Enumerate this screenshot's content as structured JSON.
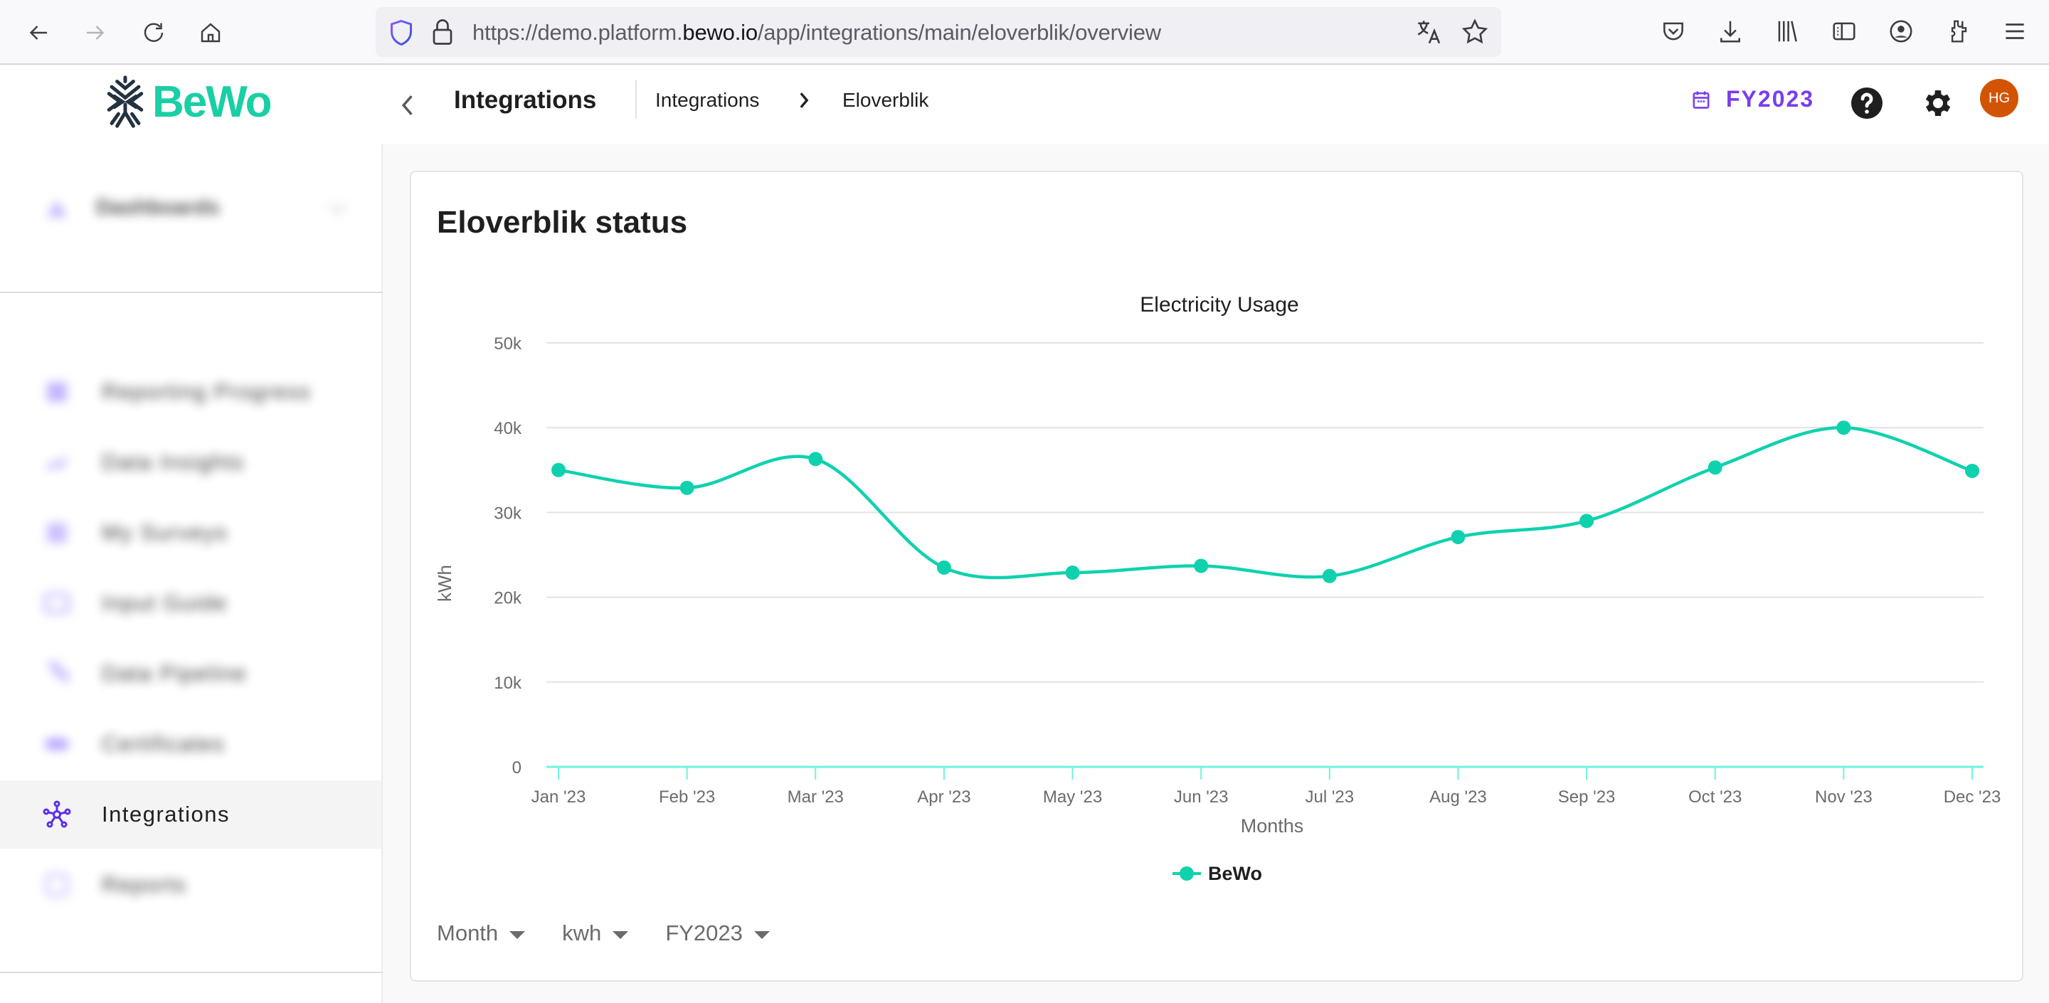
{
  "browser": {
    "url_prefix": "https://demo.platform.",
    "url_host": "bewo.io",
    "url_path": "/app/integrations/main/eloverblik/overview",
    "icons": [
      "back-icon",
      "forward-icon",
      "reload-icon",
      "home-icon",
      "shield-icon",
      "lock-icon",
      "translate-icon",
      "bookmark-star-icon",
      "pocket-icon",
      "download-icon",
      "library-icon",
      "sidebar-icon",
      "account-icon",
      "extensions-icon",
      "menu-icon"
    ]
  },
  "header": {
    "logo_text": "BeWo",
    "page_title": "Integrations",
    "breadcrumb": [
      "Integrations",
      "Eloverblik"
    ],
    "fiscal_year": "FY2023",
    "avatar_initials": "HG"
  },
  "sidebar": {
    "dashboards_label": "Dashboards",
    "items": [
      {
        "label": "Reporting Progress",
        "icon": "progress-icon",
        "blurred": true
      },
      {
        "label": "Data Insights",
        "icon": "insights-icon",
        "blurred": true
      },
      {
        "label": "My Surveys",
        "icon": "survey-icon",
        "blurred": true
      },
      {
        "label": "Input Guide",
        "icon": "guide-icon",
        "blurred": true
      },
      {
        "label": "Data Pipeline",
        "icon": "pipeline-icon",
        "blurred": true
      },
      {
        "label": "Certificates",
        "icon": "certificate-icon",
        "blurred": true
      },
      {
        "label": "Integrations",
        "icon": "integrations-icon",
        "blurred": false,
        "active": true
      },
      {
        "label": "Reports",
        "icon": "reports-icon",
        "blurred": true
      }
    ]
  },
  "card": {
    "title": "Eloverblik status",
    "controls": [
      {
        "label": "Month"
      },
      {
        "label": "kwh"
      },
      {
        "label": "FY2023"
      }
    ]
  },
  "colors": {
    "accent": "#7a3cf0",
    "brand": "#19cfa4",
    "series": "#0fd1ae",
    "axis": "#6ff2de",
    "avatar": "#d35400"
  },
  "chart_data": {
    "type": "line",
    "title": "Electricity Usage",
    "xlabel": "Months",
    "ylabel": "kWh",
    "categories": [
      "Jan '23",
      "Feb '23",
      "Mar '23",
      "Apr '23",
      "May '23",
      "Jun '23",
      "Jul '23",
      "Aug '23",
      "Sep '23",
      "Oct '23",
      "Nov '23",
      "Dec '23"
    ],
    "series": [
      {
        "name": "BeWo",
        "values": [
          35000,
          32900,
          36300,
          23500,
          22900,
          23700,
          22500,
          27100,
          29000,
          35300,
          40000,
          34900
        ]
      }
    ],
    "ylim": [
      0,
      50000
    ],
    "yticks": [
      0,
      10000,
      20000,
      30000,
      40000,
      50000
    ],
    "ytick_labels": [
      "0",
      "10k",
      "20k",
      "30k",
      "40k",
      "50k"
    ],
    "grid": true,
    "smooth": true,
    "legend": "bottom-center"
  }
}
